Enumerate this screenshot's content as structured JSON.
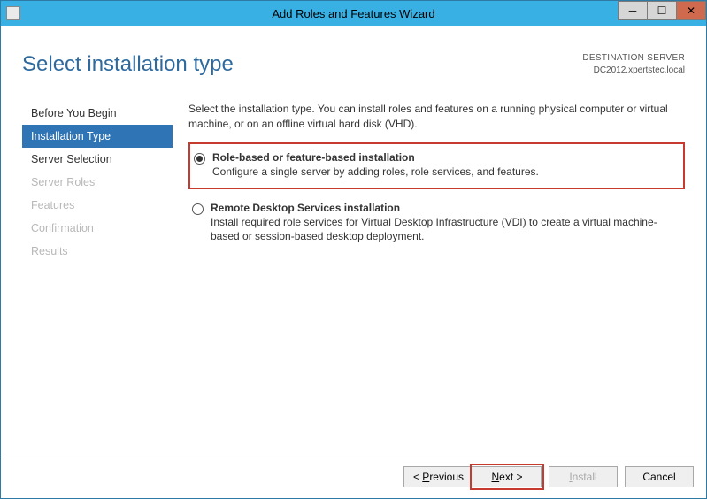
{
  "titlebar": {
    "title": "Add Roles and Features Wizard"
  },
  "header": {
    "page_title": "Select installation type",
    "dest_label": "DESTINATION SERVER",
    "dest_value": "DC2012.xpertstec.local"
  },
  "nav": {
    "items": [
      {
        "label": "Before You Begin",
        "state": "normal"
      },
      {
        "label": "Installation Type",
        "state": "active"
      },
      {
        "label": "Server Selection",
        "state": "normal"
      },
      {
        "label": "Server Roles",
        "state": "disabled"
      },
      {
        "label": "Features",
        "state": "disabled"
      },
      {
        "label": "Confirmation",
        "state": "disabled"
      },
      {
        "label": "Results",
        "state": "disabled"
      }
    ]
  },
  "main": {
    "intro": "Select the installation type. You can install roles and features on a running physical computer or virtual machine, or on an offline virtual hard disk (VHD).",
    "options": [
      {
        "title": "Role-based or feature-based installation",
        "desc": "Configure a single server by adding roles, role services, and features.",
        "checked": true,
        "highlight": true
      },
      {
        "title": "Remote Desktop Services installation",
        "desc": "Install required role services for Virtual Desktop Infrastructure (VDI) to create a virtual machine-based or session-based desktop deployment.",
        "checked": false,
        "highlight": false
      }
    ]
  },
  "footer": {
    "previous": "< Previous",
    "next": "Next >",
    "install": "Install",
    "cancel": "Cancel"
  }
}
